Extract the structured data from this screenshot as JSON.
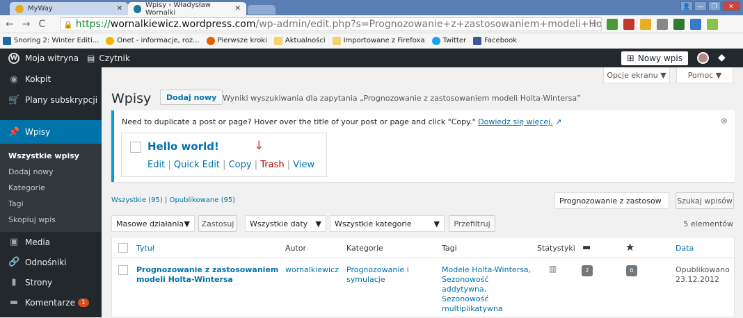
{
  "browser": {
    "tabs": [
      {
        "title": "MyWay"
      },
      {
        "title": "Wpisy ‹ Władysław Wornalki"
      }
    ],
    "url": {
      "scheme": "https://",
      "host": "wornalkiewicz.wordpress.com",
      "path": "/wp-admin/edit.php?s=Prognozowanie+z+zastosowaniem+modeli+Holta-Wintersa&p"
    },
    "bookmarks": [
      "Snoring 2: Winter Editi...",
      "Onet - informacje, roz...",
      "Pierwsze kroki",
      "Aktualności",
      "Importowane z Firefoxa",
      "Twitter",
      "Facebook"
    ]
  },
  "adminbar": {
    "my_site": "Moja witryna",
    "reader": "Czytnik",
    "new_post": "Nowy wpis"
  },
  "sidebar": {
    "items": [
      {
        "label": "Kokpit",
        "icon": "dashboard-icon"
      },
      {
        "label": "Plany subskrypcji",
        "icon": "cart-icon"
      },
      {
        "label": "Wpisy",
        "icon": "pin-icon"
      },
      {
        "label": "Media",
        "icon": "media-icon"
      },
      {
        "label": "Odnośniki",
        "icon": "link-icon"
      },
      {
        "label": "Strony",
        "icon": "page-icon"
      },
      {
        "label": "Komentarze",
        "icon": "comment-icon",
        "badge": "1"
      }
    ],
    "sub": [
      "Wszystkie wpisy",
      "Dodaj nowy",
      "Kategorie",
      "Tagi",
      "Skopiuj wpis"
    ]
  },
  "header": {
    "screen_options": "Opcje ekranu ▼",
    "help": "Pomoc ▼",
    "title": "Wpisy",
    "add_new": "Dodaj nowy",
    "search_results": "Wyniki wyszukiwania dla zapytania „Prognozowanie z zastosowaniem modeli Holta-Wintersa”"
  },
  "notice": {
    "text": "Need to duplicate a post or page? Hover over the title of your post or page and click \"Copy.\"",
    "link": "Dowiedz się więcej.",
    "demo_title": "Hello world!",
    "actions": [
      "Edit",
      "Quick Edit",
      "Copy",
      "Trash",
      "View"
    ]
  },
  "filters": {
    "all": "Wszystkie (95)",
    "sep": "|",
    "published": "Opublikowane (95)",
    "search_value": "Prognozowanie z zastosow",
    "search_button": "Szukaj wpisów",
    "bulk": "Masowe działania",
    "apply": "Zastosuj",
    "dates": "Wszystkie daty",
    "categories": "Wszystkie kategorie",
    "filter": "Przefiltruj",
    "count": "5 elementów"
  },
  "table": {
    "columns": [
      "Tytuł",
      "Autor",
      "Kategorie",
      "Tagi",
      "Statystyki",
      "Data"
    ],
    "rows": [
      {
        "title_line1": "Prognozowanie z zastosowaniem",
        "title_line2": "modeli Holta-Wintersa",
        "author": "wornalkiewicz",
        "cat_line1": "Prognozowanie i",
        "cat_line2": "symulacje",
        "tags": [
          "Modele Holta-Wintersa,",
          "Sezonowość",
          "addytywna,",
          "Sezonowość",
          "multiplikatywna"
        ],
        "comments": "2",
        "pending": "0",
        "status": "Opublikowano",
        "date": "23.12.2012"
      }
    ]
  }
}
